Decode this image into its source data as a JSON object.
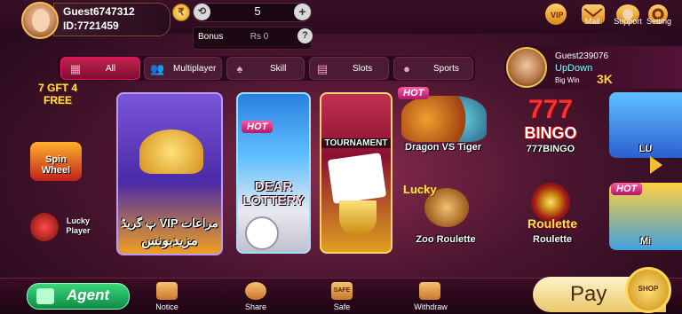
{
  "user": {
    "name": "Guest6747312",
    "id": "ID:7721459"
  },
  "balance": {
    "amount": "5",
    "bonus_label": "Bonus",
    "bonus_value": "Rs  0"
  },
  "top_menu": [
    {
      "name": "vip",
      "label": "",
      "icon": "vip-icon"
    },
    {
      "name": "mail",
      "label": "Mail",
      "icon": "mail-icon"
    },
    {
      "name": "support",
      "label": "Support",
      "icon": "support-icon"
    },
    {
      "name": "setting",
      "label": "Setting",
      "icon": "gear-icon"
    }
  ],
  "tabs": [
    {
      "label": "All",
      "icon": "grid-icon",
      "active": true
    },
    {
      "label": "Multiplayer",
      "icon": "users-icon",
      "active": false
    },
    {
      "label": "Skill",
      "icon": "cards-icon",
      "active": false
    },
    {
      "label": "Slots",
      "icon": "slot-machine-icon",
      "active": false
    },
    {
      "label": "Sports",
      "icon": "basketball-icon",
      "active": false
    }
  ],
  "live_win": {
    "name": "Guest239076",
    "game": "UpDown",
    "label": "Big Win",
    "amount": "3K"
  },
  "side_promos": [
    {
      "text": "7 GFT 4 FREE"
    },
    {
      "text": "Spin Wheel"
    },
    {
      "text": "Lucky Player"
    }
  ],
  "feature_cards": [
    {
      "line1": "پ گریڈ VIP مراعات",
      "line2": "مزیدبونس"
    },
    {
      "hot": "HOT",
      "title": "DEAR",
      "subtitle": "LOTTERY"
    },
    {
      "title": "TOURNAMENT"
    }
  ],
  "games": [
    {
      "title": "Dragon VS Tiger",
      "hot": "HOT"
    },
    {
      "title": "777BINGO",
      "badge": "BINGO"
    },
    {
      "title": "LU"
    },
    {
      "title": "Zoo Roulette",
      "badge": "Lucky"
    },
    {
      "title": "Roulette",
      "badge": "Roulette"
    },
    {
      "title": "Mi",
      "hot": "HOT"
    }
  ],
  "bottom_nav": [
    {
      "label": "Notice",
      "icon": "notice-icon"
    },
    {
      "label": "Share",
      "icon": "handshake-icon"
    },
    {
      "label": "Safe",
      "icon": "safe-icon",
      "icon_text": "SAFE"
    },
    {
      "label": "Withdraw",
      "icon": "withdraw-icon"
    }
  ],
  "agent_label": "Agent",
  "pay_label": "Pay",
  "shop_label": "SHOP",
  "colors": {
    "accent": "#c3244f",
    "gold": "#ffd23a",
    "agent": "#1fb35e"
  }
}
